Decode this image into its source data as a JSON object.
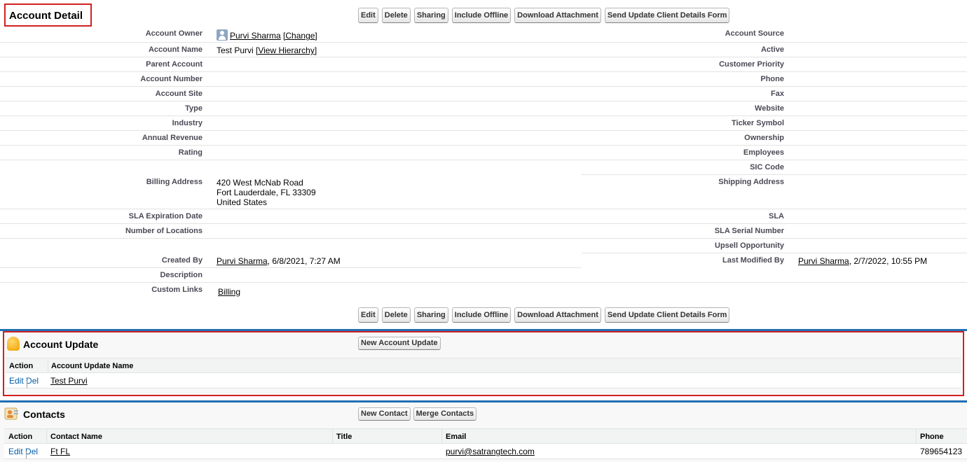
{
  "detail": {
    "title": "Account Detail",
    "buttons": [
      "Edit",
      "Delete",
      "Sharing",
      "Include Offline",
      "Download Attachment",
      "Send Update Client Details Form"
    ]
  },
  "left_fields": {
    "account_owner": {
      "label": "Account Owner",
      "name": "Purvi Sharma",
      "action": "[Change]"
    },
    "account_name": {
      "label": "Account Name",
      "value": "Test Purvi ",
      "action": "[View Hierarchy]"
    },
    "parent_account": {
      "label": "Parent Account"
    },
    "account_number": {
      "label": "Account Number"
    },
    "account_site": {
      "label": "Account Site"
    },
    "type": {
      "label": "Type"
    },
    "industry": {
      "label": "Industry"
    },
    "annual_revenue": {
      "label": "Annual Revenue"
    },
    "rating": {
      "label": "Rating"
    },
    "billing_address": {
      "label": "Billing Address",
      "line1": "420 West McNab Road",
      "line2": "Fort Lauderdale, FL 33309",
      "line3": "United States"
    },
    "sla_expiration": {
      "label": "SLA Expiration Date"
    },
    "num_locations": {
      "label": "Number of Locations"
    },
    "created_by": {
      "label": "Created By",
      "name": "Purvi Sharma",
      "date": ", 6/8/2021, 7:27 AM"
    },
    "description": {
      "label": "Description"
    },
    "custom_links": {
      "label": "Custom Links",
      "link": "Billing"
    }
  },
  "right_fields": {
    "account_source": {
      "label": "Account Source"
    },
    "active": {
      "label": "Active"
    },
    "customer_priority": {
      "label": "Customer Priority"
    },
    "phone": {
      "label": "Phone"
    },
    "fax": {
      "label": "Fax"
    },
    "website": {
      "label": "Website"
    },
    "ticker": {
      "label": "Ticker Symbol"
    },
    "ownership": {
      "label": "Ownership"
    },
    "employees": {
      "label": "Employees"
    },
    "sic_code": {
      "label": "SIC Code"
    },
    "shipping_address": {
      "label": "Shipping Address"
    },
    "sla": {
      "label": "SLA"
    },
    "sla_serial": {
      "label": "SLA Serial Number"
    },
    "upsell": {
      "label": "Upsell Opportunity"
    },
    "last_modified": {
      "label": "Last Modified By",
      "name": "Purvi Sharma",
      "date": ", 2/7/2022, 10:55 PM"
    }
  },
  "account_update": {
    "title": "Account Update",
    "new_button": "New Account Update",
    "columns": [
      "Action",
      "Account Update Name"
    ],
    "rows": [
      {
        "edit": "Edit",
        "sep": "|",
        "del": "Del",
        "name": "Test Purvi"
      }
    ]
  },
  "contacts": {
    "title": "Contacts",
    "buttons": [
      "New Contact",
      "Merge Contacts"
    ],
    "columns": [
      "Action",
      "Contact Name",
      "Title",
      "Email",
      "Phone"
    ],
    "rows": [
      {
        "edit": "Edit",
        "sep": "|",
        "del": "Del",
        "name": "Ft FL",
        "title": "",
        "email": "purvi@satrangtech.com",
        "phone": "789654123"
      }
    ]
  },
  "colors": {
    "accent_red": "#d42020",
    "section_blue": "#1f6fb5",
    "link_blue": "#015ba7"
  }
}
